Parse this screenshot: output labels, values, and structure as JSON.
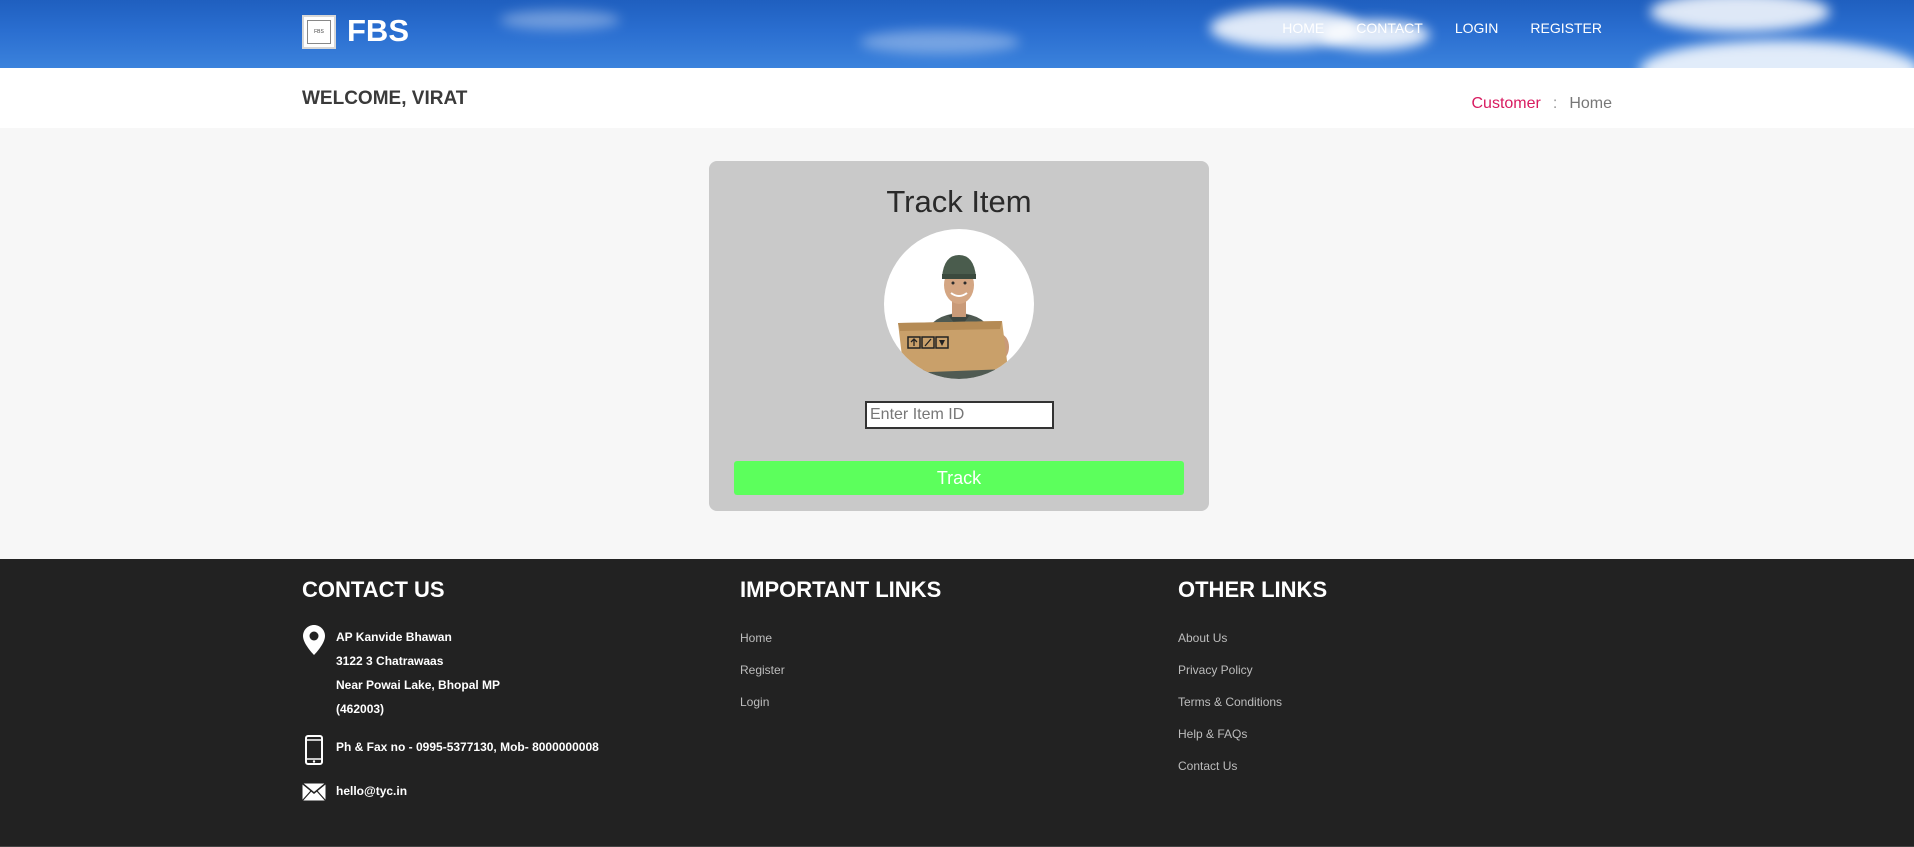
{
  "header": {
    "logo_text": "FBS",
    "brand": "FBS",
    "nav": [
      "HOME",
      "CONTACT",
      "LOGIN",
      "REGISTER"
    ]
  },
  "subheader": {
    "welcome": "WELCOME, VIRAT",
    "breadcrumb": {
      "customer": "Customer",
      "separator": ":",
      "home": "Home"
    }
  },
  "track": {
    "title": "Track Item",
    "input_placeholder": "Enter Item ID",
    "input_value": "",
    "button_label": "Track"
  },
  "footer": {
    "contact": {
      "heading": "CONTACT US",
      "address_lines": [
        "AP Kanvide Bhawan",
        "3122 3 Chatrawaas",
        "Near Powai Lake, Bhopal MP",
        "(462003)"
      ],
      "phone": "Ph & Fax no - 0995-5377130, Mob- 8000000008",
      "email": "hello@tyc.in"
    },
    "important": {
      "heading": "IMPORTANT LINKS",
      "links": [
        "Home",
        "Register",
        "Login"
      ]
    },
    "other": {
      "heading": "OTHER LINKS",
      "links": [
        "About Us",
        "Privacy Policy",
        "Terms & Conditions",
        "Help & FAQs",
        "Contact Us"
      ]
    }
  },
  "colors": {
    "header_blue": "#2a6ed0",
    "breadcrumb_accent": "#d81b60",
    "track_button": "#5cff5c",
    "footer_bg": "#222222",
    "card_bg": "#c9c9c9"
  }
}
